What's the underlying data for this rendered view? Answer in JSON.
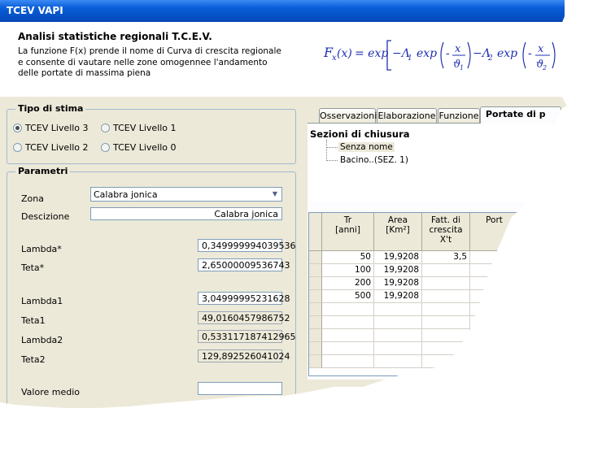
{
  "window": {
    "title": "TCEV VAPI"
  },
  "header": {
    "title": "Analisi statistiche regionali T.C.E.V.",
    "description": "La funzione F(x) prende il nome di Curva di crescita regionale e consente di vautare nelle zone omogennee l'andamento delle portate di massima piena"
  },
  "formula": {
    "lhs": "F",
    "lhs_sub": "x",
    "lhs_arg": "(x)",
    "eq": "= exp",
    "lambda1": "−Λ",
    "lambda1_sub": "1",
    "exp1": "exp",
    "minus": "-",
    "x1": "x",
    "theta1": "ϑ",
    "theta1_sub": "1",
    "lambda2": "−Λ",
    "lambda2_sub": "2",
    "exp2": "exp",
    "minus2": "-",
    "x2": "x",
    "theta2": "ϑ",
    "theta2_sub": "2"
  },
  "tipo_stima": {
    "legend": "Tipo di stima",
    "options": [
      {
        "label": "TCEV Livello 3",
        "selected": true
      },
      {
        "label": "TCEV Livello 1",
        "selected": false
      },
      {
        "label": "TCEV Livello 2",
        "selected": false
      },
      {
        "label": "TCEV Livello 0",
        "selected": false
      }
    ]
  },
  "parametri": {
    "legend": "Parametri",
    "zona_label": "Zona",
    "zona_value": "Calabra jonica",
    "descrizione_label": "Descizione",
    "descrizione_value": "Calabra jonica",
    "lambda_star_label": "Lambda*",
    "lambda_star_value": "0,349999994039536",
    "teta_star_label": "Teta*",
    "teta_star_value": "2,65000009536743",
    "lambda1_label": "Lambda1",
    "lambda1_value": "3,04999995231628",
    "teta1_label": "Teta1",
    "teta1_value": "49,0160457986752",
    "lambda2_label": "Lambda2",
    "lambda2_value": "0,533117187412965",
    "teta2_label": "Teta2",
    "teta2_value": "129,892526041024",
    "valore_medio_label": "Valore medio",
    "valore_medio_value": ""
  },
  "tabs": [
    {
      "label": "Osservazioni",
      "active": false
    },
    {
      "label": "Elaborazione",
      "active": false
    },
    {
      "label": "Funzione",
      "active": false
    },
    {
      "label": "Portate di p",
      "active": true
    }
  ],
  "sezioni": {
    "title": "Sezioni di chiusura",
    "items": [
      "Senza nome",
      "Bacino..(SEZ.  1)"
    ]
  },
  "grid": {
    "headers": [
      "Tr\n[anni]",
      "Area\n[Km²]",
      "Fatt. di\ncrescita\nX't",
      "Port"
    ],
    "rows": [
      [
        "50",
        "19,9208",
        "3,5"
      ],
      [
        "100",
        "19,9208",
        ""
      ],
      [
        "200",
        "19,9208",
        ""
      ],
      [
        "500",
        "19,9208",
        ""
      ]
    ]
  },
  "colors": {
    "titlebar": "#0a5ed8",
    "panel": "#ece9d8",
    "formula": "#1f2fb0"
  }
}
